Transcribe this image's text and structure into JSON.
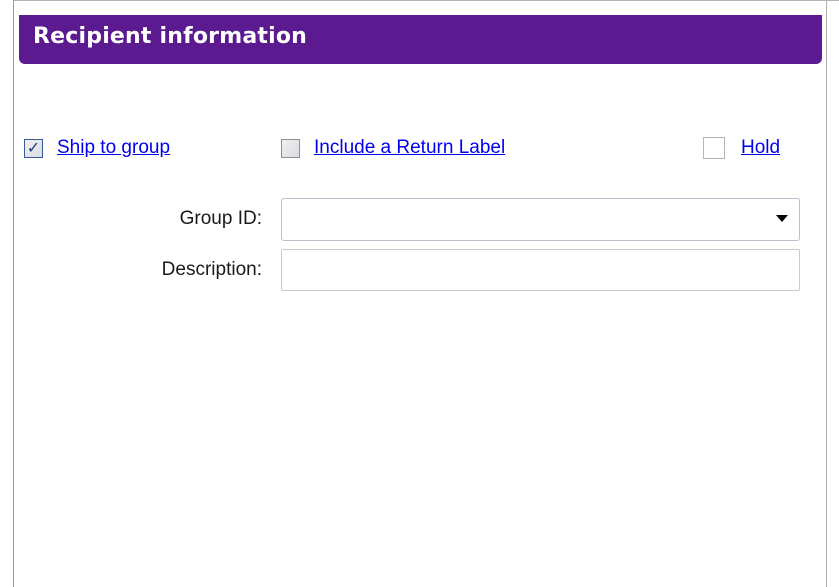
{
  "panel": {
    "title": "Recipient information"
  },
  "options": {
    "ship_to_group": {
      "label": "Ship to group",
      "checked": true
    },
    "include_return_label": {
      "label": "Include a Return Label",
      "checked": false
    },
    "hold": {
      "label": "Hold",
      "checked": false
    }
  },
  "form": {
    "group_id": {
      "label": "Group ID:",
      "value": ""
    },
    "description": {
      "label": "Description:",
      "value": ""
    }
  },
  "icons": {
    "check": "check-mark",
    "dropdown": "triangle-down"
  }
}
